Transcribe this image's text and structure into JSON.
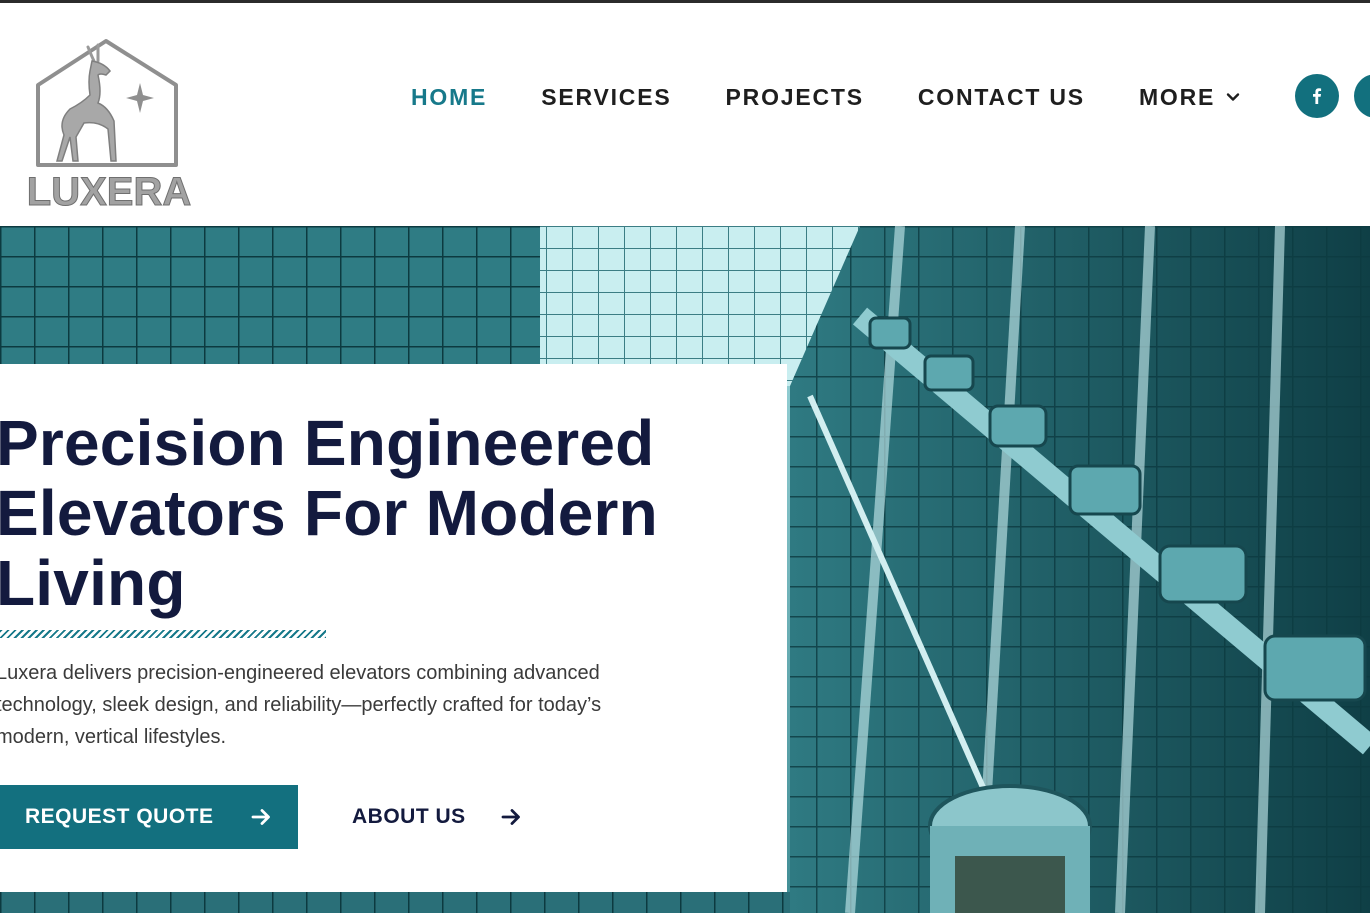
{
  "brand": {
    "name": "LUXERA"
  },
  "nav": {
    "items": [
      {
        "label": "HOME",
        "active": true
      },
      {
        "label": "SERVICES"
      },
      {
        "label": "PROJECTS"
      },
      {
        "label": "CONTACT US"
      },
      {
        "label": "MORE",
        "has_dropdown": true
      }
    ]
  },
  "social": [
    {
      "icon": "facebook-icon",
      "label": "f"
    },
    {
      "icon": "social-icon"
    }
  ],
  "hero": {
    "title_lines": [
      "Precision Engineered",
      "Elevators For Modern",
      "Living"
    ],
    "description_lines": [
      "Luxera delivers precision-engineered elevators combining advanced",
      "technology, sleek design, and reliability—perfectly crafted for today’s",
      "modern, vertical lifestyles."
    ],
    "primary_button": "REQUEST QUOTE",
    "secondary_button": "ABOUT US"
  },
  "colors": {
    "accent": "#17798a",
    "navy": "#131a3e",
    "hero_tint": "#1e5962"
  }
}
